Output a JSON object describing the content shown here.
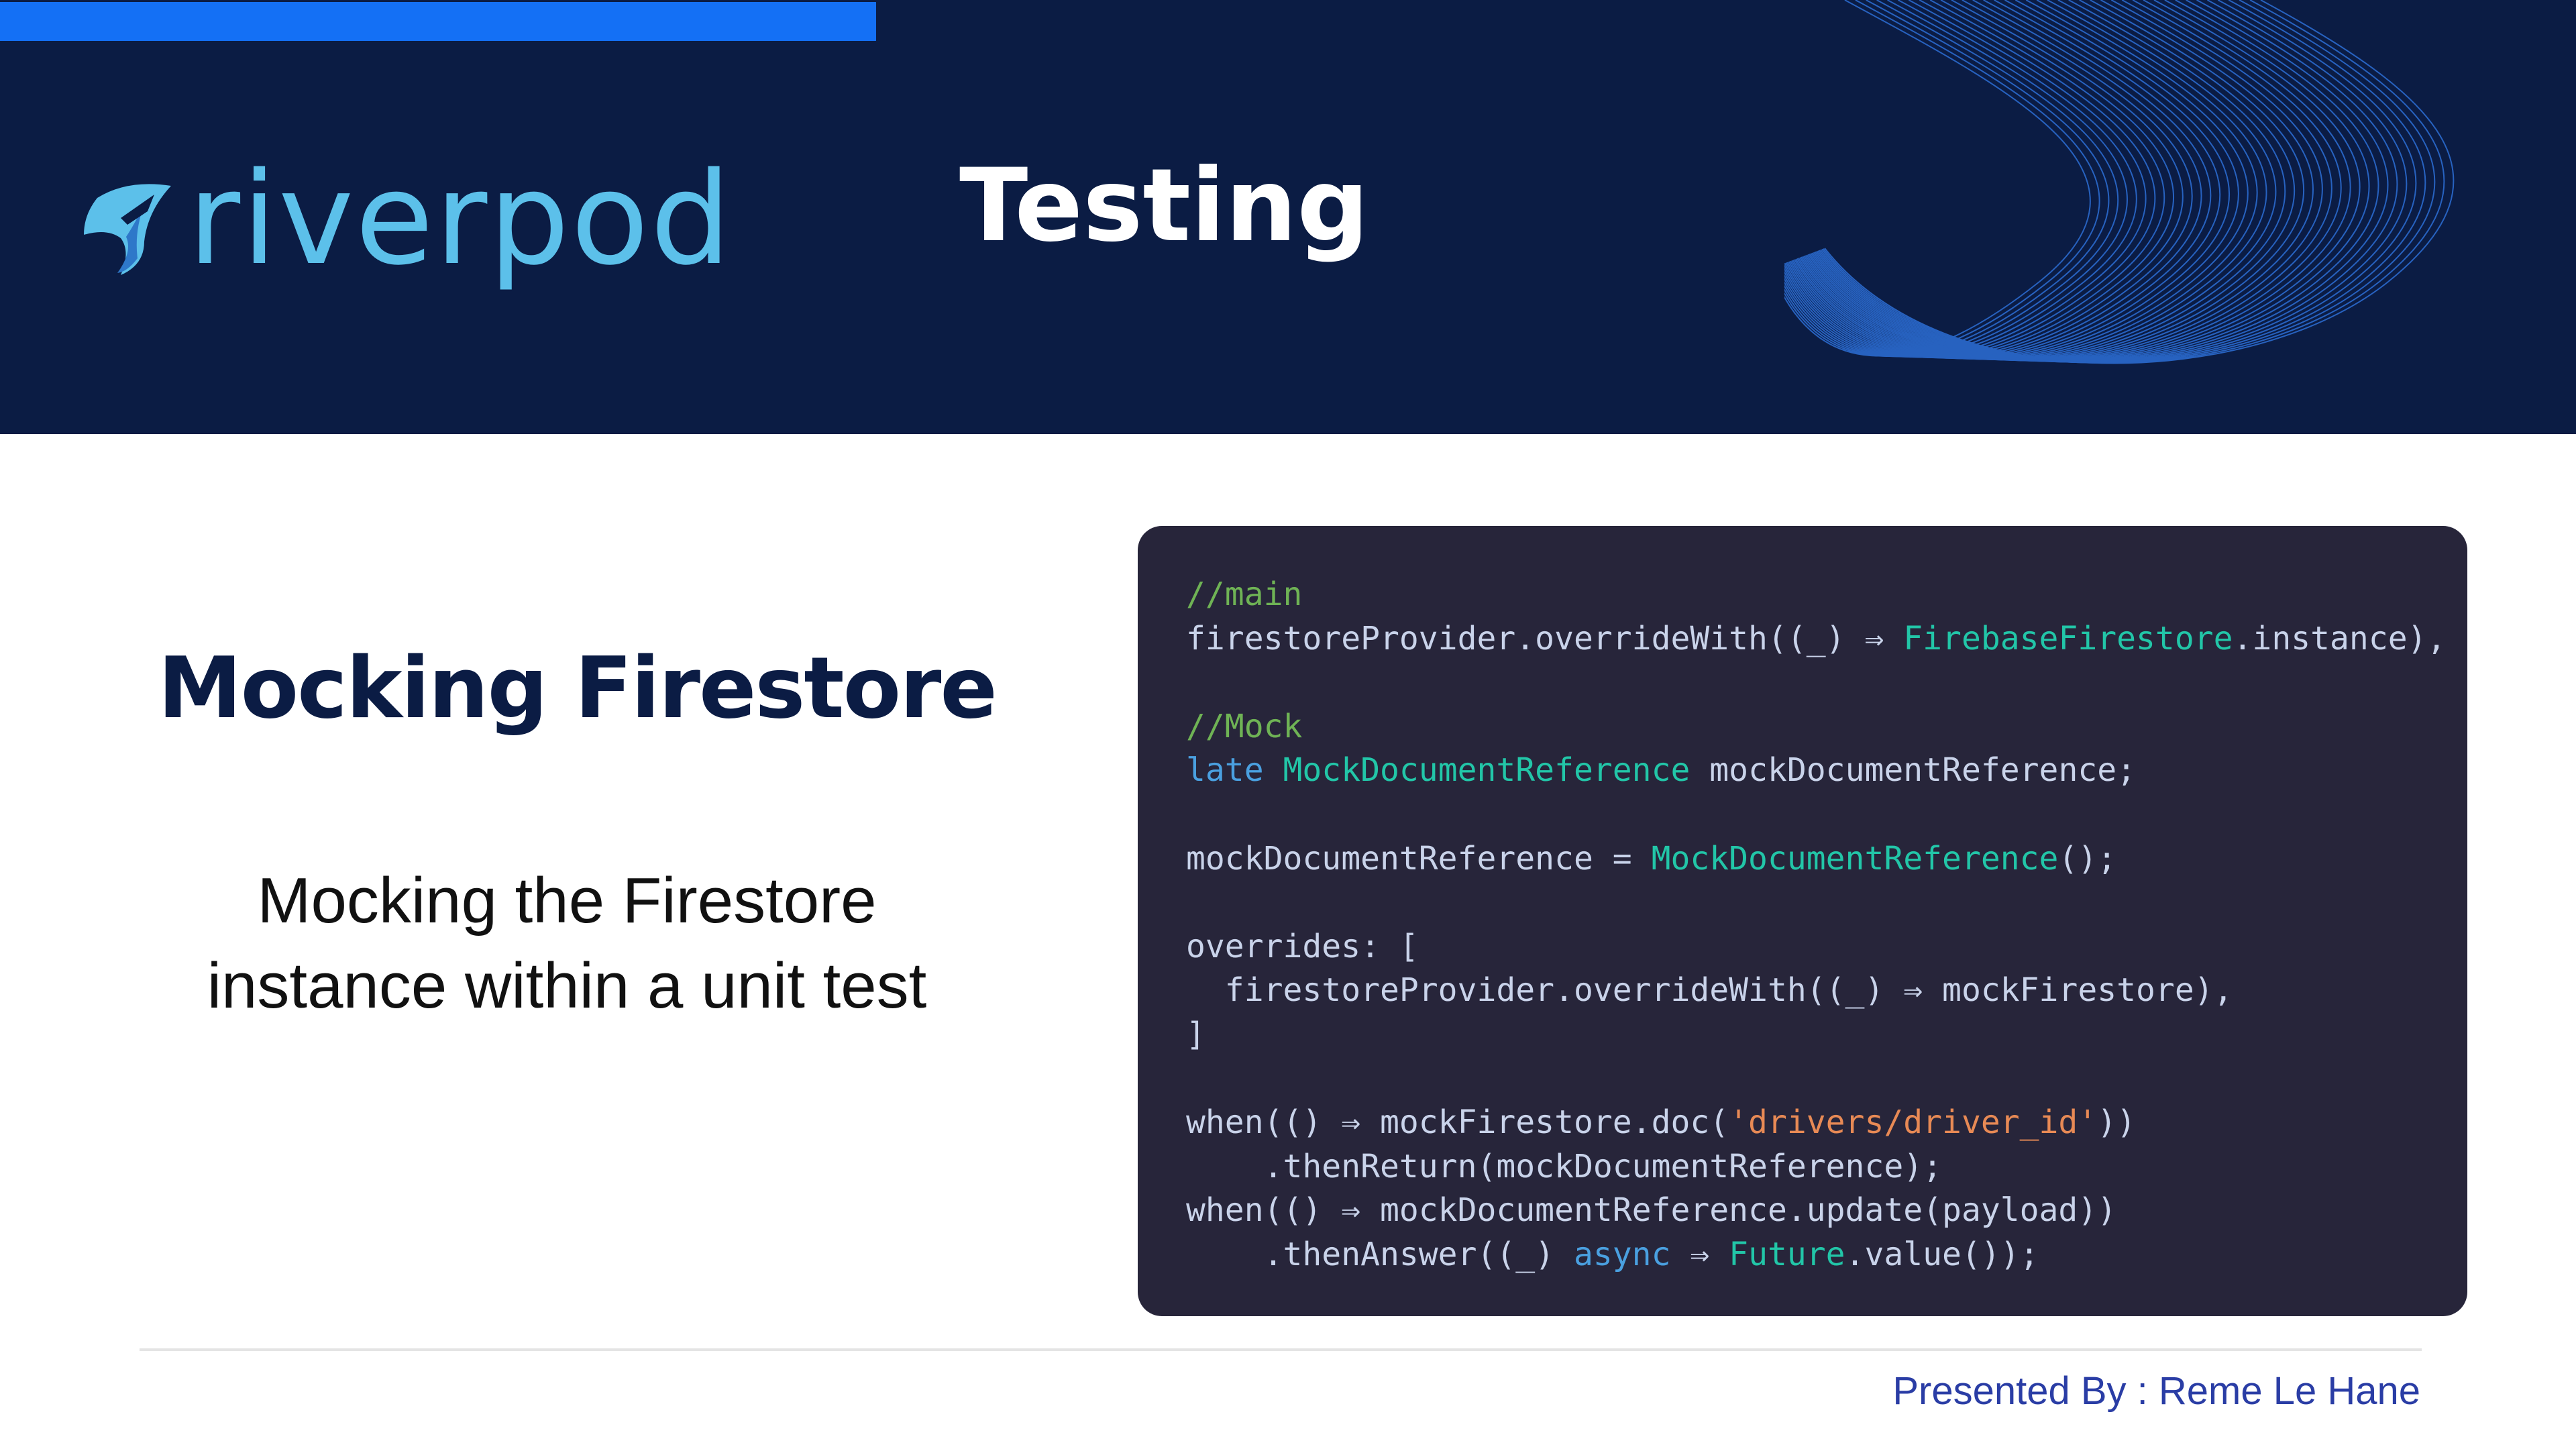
{
  "header": {
    "logo_text": "riverpod",
    "title": "Testing"
  },
  "slide": {
    "title": "Mocking Firestore",
    "subtitle_line1": "Mocking the Firestore",
    "subtitle_line2": "instance within a unit test"
  },
  "code": {
    "lines": [
      [
        {
          "t": "//main",
          "c": "comment"
        }
      ],
      [
        {
          "t": "firestoreProvider.overrideWith((_) ⇒ ",
          "c": "plain"
        },
        {
          "t": "FirebaseFirestore",
          "c": "class"
        },
        {
          "t": ".instance),",
          "c": "plain"
        }
      ],
      [],
      [
        {
          "t": "//Mock",
          "c": "comment"
        }
      ],
      [
        {
          "t": "late",
          "c": "kw"
        },
        {
          "t": " ",
          "c": "plain"
        },
        {
          "t": "MockDocumentReference",
          "c": "class"
        },
        {
          "t": " mockDocumentReference;",
          "c": "plain"
        }
      ],
      [],
      [
        {
          "t": "mockDocumentReference = ",
          "c": "plain"
        },
        {
          "t": "MockDocumentReference",
          "c": "class"
        },
        {
          "t": "();",
          "c": "plain"
        }
      ],
      [],
      [
        {
          "t": "overrides: [",
          "c": "plain"
        }
      ],
      [
        {
          "t": "  firestoreProvider.overrideWith((_) ⇒ mockFirestore),",
          "c": "plain"
        }
      ],
      [
        {
          "t": "]",
          "c": "plain"
        }
      ],
      [],
      [
        {
          "t": "when(() ⇒ mockFirestore.doc(",
          "c": "plain"
        },
        {
          "t": "'drivers/driver_id'",
          "c": "str"
        },
        {
          "t": "))",
          "c": "plain"
        }
      ],
      [
        {
          "t": "    .thenReturn(mockDocumentReference);",
          "c": "plain"
        }
      ],
      [
        {
          "t": "when(() ⇒ mockDocumentReference.update(payload))",
          "c": "plain"
        }
      ],
      [
        {
          "t": "    .thenAnswer((_) ",
          "c": "plain"
        },
        {
          "t": "async",
          "c": "kw"
        },
        {
          "t": " ⇒ ",
          "c": "plain"
        },
        {
          "t": "Future",
          "c": "class"
        },
        {
          "t": ".value());",
          "c": "plain"
        }
      ]
    ]
  },
  "footer": {
    "presenter": "Presented By : Reme Le Hane"
  },
  "colors": {
    "header_bg": "#0b1c44",
    "accent": "#1470f5",
    "logo": "#5cc0ea",
    "code_bg": "#27253a",
    "comment": "#6fb355",
    "class": "#22c6a8",
    "keyword": "#4aa0e0",
    "string": "#e88a55",
    "footer_text": "#2a3da5"
  }
}
